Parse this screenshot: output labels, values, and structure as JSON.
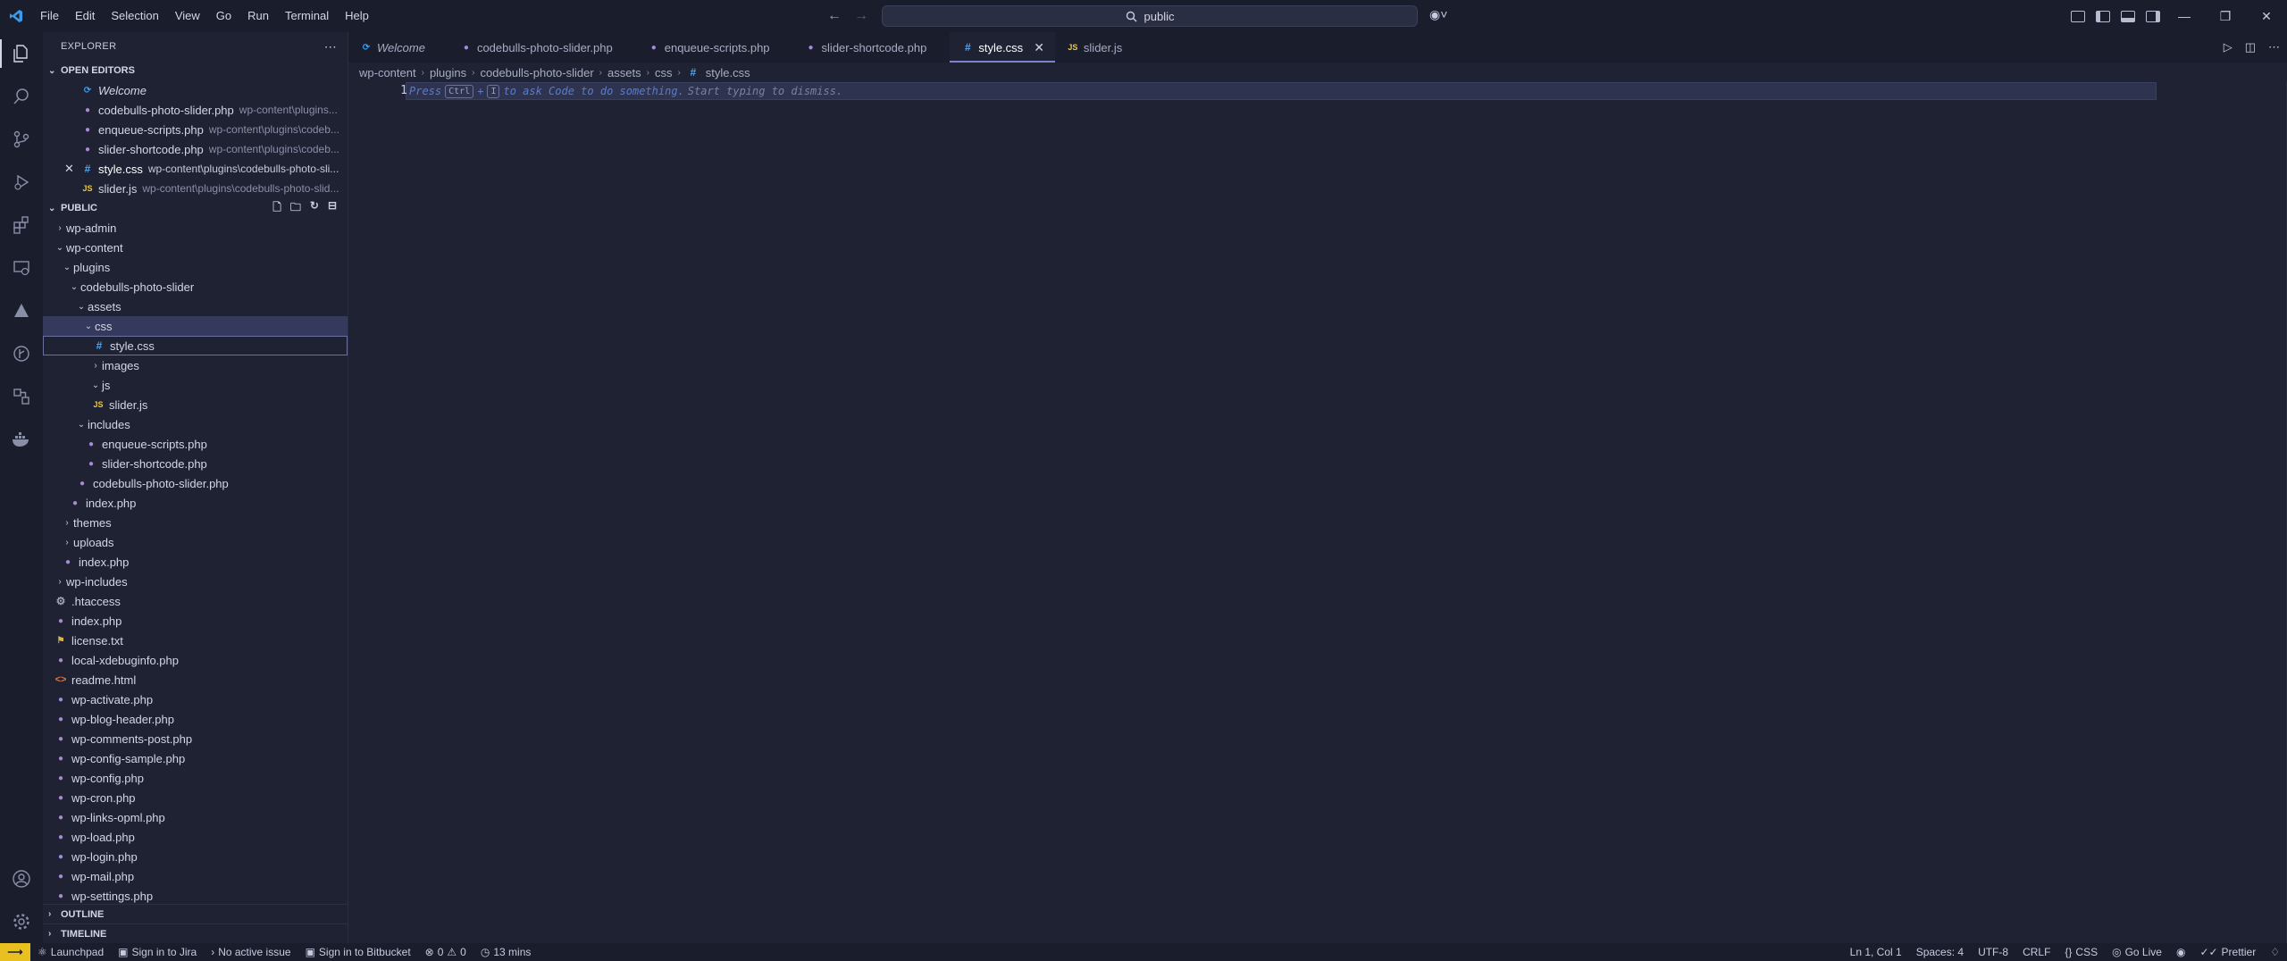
{
  "menu": [
    "File",
    "Edit",
    "Selection",
    "View",
    "Go",
    "Run",
    "Terminal",
    "Help"
  ],
  "search": {
    "text": "public"
  },
  "sidebar": {
    "title": "EXPLORER",
    "open_editors_title": "OPEN EDITORS",
    "open_editors": [
      {
        "name": "Welcome",
        "path": "",
        "icon": "vscode-icon"
      },
      {
        "name": "codebulls-photo-slider.php",
        "path": "wp-content\\plugins...",
        "icon": "php-icon"
      },
      {
        "name": "enqueue-scripts.php",
        "path": "wp-content\\plugins\\codeb...",
        "icon": "php-icon"
      },
      {
        "name": "slider-shortcode.php",
        "path": "wp-content\\plugins\\codeb...",
        "icon": "php-icon"
      },
      {
        "name": "style.css",
        "path": "wp-content\\plugins\\codebulls-photo-sli...",
        "icon": "css-icon"
      },
      {
        "name": "slider.js",
        "path": "wp-content\\plugins\\codebulls-photo-slid...",
        "icon": "js-icon"
      }
    ],
    "public_title": "PUBLIC",
    "tree": [
      {
        "label": "wp-admin"
      },
      {
        "label": "wp-content"
      },
      {
        "label": "plugins"
      },
      {
        "label": "codebulls-photo-slider"
      },
      {
        "label": "assets"
      },
      {
        "label": "css"
      },
      {
        "label": "style.css"
      },
      {
        "label": "images"
      },
      {
        "label": "js"
      },
      {
        "label": "slider.js"
      },
      {
        "label": "includes"
      },
      {
        "label": "enqueue-scripts.php"
      },
      {
        "label": "slider-shortcode.php"
      },
      {
        "label": "codebulls-photo-slider.php"
      },
      {
        "label": "index.php"
      },
      {
        "label": "themes"
      },
      {
        "label": "uploads"
      },
      {
        "label": "index.php"
      },
      {
        "label": "wp-includes"
      },
      {
        "label": ".htaccess"
      },
      {
        "label": "index.php"
      },
      {
        "label": "license.txt"
      },
      {
        "label": "local-xdebuginfo.php"
      },
      {
        "label": "readme.html"
      },
      {
        "label": "wp-activate.php"
      },
      {
        "label": "wp-blog-header.php"
      },
      {
        "label": "wp-comments-post.php"
      },
      {
        "label": "wp-config-sample.php"
      },
      {
        "label": "wp-config.php"
      },
      {
        "label": "wp-cron.php"
      },
      {
        "label": "wp-links-opml.php"
      },
      {
        "label": "wp-load.php"
      },
      {
        "label": "wp-login.php"
      },
      {
        "label": "wp-mail.php"
      },
      {
        "label": "wp-settings.php"
      }
    ],
    "outline_title": "OUTLINE",
    "timeline_title": "TIMELINE"
  },
  "tabs": [
    {
      "label": "Welcome"
    },
    {
      "label": "codebulls-photo-slider.php"
    },
    {
      "label": "enqueue-scripts.php"
    },
    {
      "label": "slider-shortcode.php"
    },
    {
      "label": "style.css"
    },
    {
      "label": "slider.js"
    }
  ],
  "breadcrumb": [
    "wp-content",
    "plugins",
    "codebulls-photo-slider",
    "assets",
    "css",
    "style.css"
  ],
  "editor": {
    "line_number": "1",
    "hint_press": "Press",
    "hint_key1": "Ctrl",
    "hint_plus": "+",
    "hint_key2": "I",
    "hint_text": "to ask Code to do something.",
    "hint_dismiss": "Start typing to dismiss."
  },
  "status": {
    "launchpad": "Launchpad",
    "jira": "Sign in to Jira",
    "issue": "No active issue",
    "bitbucket": "Sign in to Bitbucket",
    "errors": "0",
    "warnings": "0",
    "time": "13 mins",
    "position": "Ln 1, Col 1",
    "spaces": "Spaces: 4",
    "encoding": "UTF-8",
    "eol": "CRLF",
    "language": "CSS",
    "golive": "Go Live",
    "prettier": "Prettier"
  },
  "colors": {
    "accent": "#7b83c8",
    "remote": "#e8c020",
    "background": "#1f2233"
  }
}
